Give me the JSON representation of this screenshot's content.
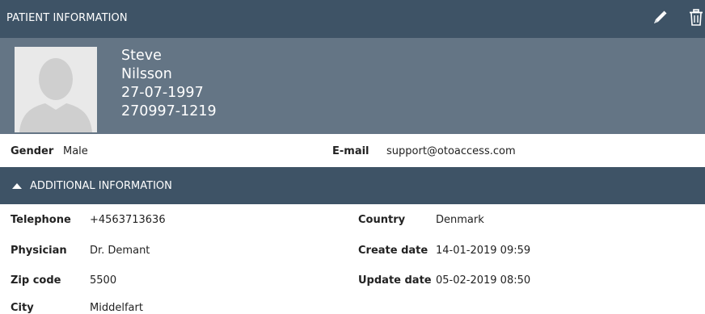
{
  "header": {
    "title": "PATIENT INFORMATION",
    "edit_icon": "pencil-icon",
    "delete_icon": "trash-icon"
  },
  "patient": {
    "first_name": "Steve",
    "last_name": "Nilsson",
    "birth_date": "27-07-1997",
    "id_number": "270997-1219",
    "avatar_icon": "person-silhouette-icon"
  },
  "basic": {
    "gender_label": "Gender",
    "gender_value": "Male",
    "email_label": "E-mail",
    "email_value": "support@otoaccess.com"
  },
  "additional": {
    "title": "ADDITIONAL INFORMATION",
    "toggle_icon": "caret-up-icon",
    "left": [
      {
        "label": "Telephone",
        "value": "+4563713636"
      },
      {
        "label": "Physician",
        "value": "Dr. Demant"
      },
      {
        "label": "Zip code",
        "value": "5500"
      },
      {
        "label": "City",
        "value": "Middelfart"
      }
    ],
    "right": [
      {
        "label": "Country",
        "value": "Denmark"
      },
      {
        "label": "Create date",
        "value": "14-01-2019 09:59"
      },
      {
        "label": "Update date",
        "value": "05-02-2019 08:50"
      }
    ]
  },
  "colors": {
    "header": "#3e5366",
    "card": "#647585",
    "text": "#222222"
  }
}
